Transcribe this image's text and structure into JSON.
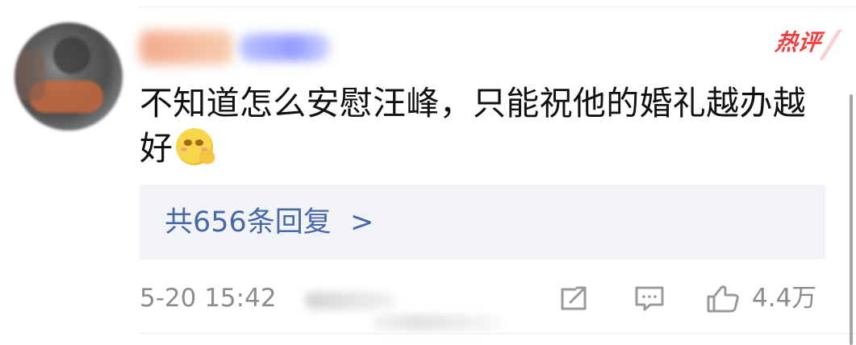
{
  "comment": {
    "hot_tag": "热评",
    "text": "不知道怎么安慰汪峰，只能祝他的婚礼越办越好",
    "replies_label": "共656条回复",
    "replies_chevron": ">",
    "timestamp": "5-20 15:42",
    "like_count": "4.4万"
  },
  "icons": {
    "emoji": "blushing-face-emoji",
    "share": "share-icon",
    "comment": "comment-icon",
    "like": "like-icon"
  },
  "colors": {
    "hot_tag": "#f04040",
    "reply_link": "#4768a5",
    "meta_text": "#8c8c8c",
    "reply_bg": "#f2f3f7"
  }
}
